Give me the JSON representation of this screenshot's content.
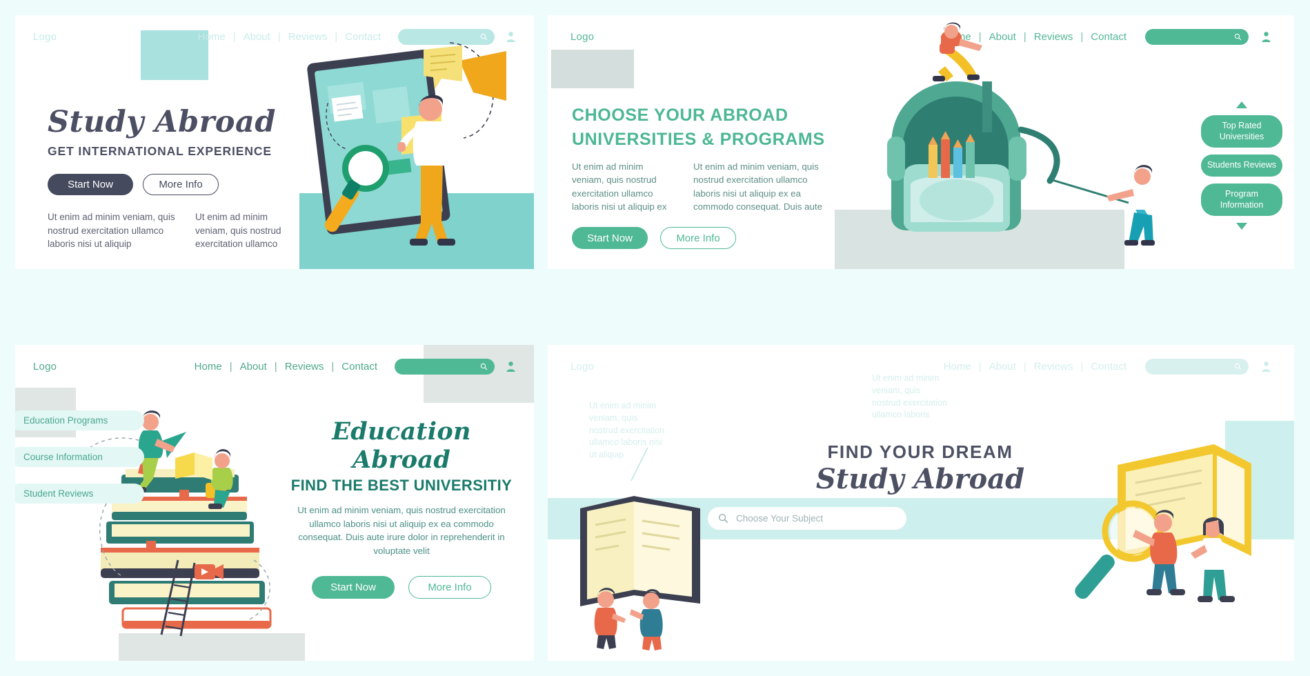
{
  "colors": {
    "page_background": "#eefcfb",
    "accent_green": "#4fb894",
    "dark_teal": "#1a7a6b",
    "slate": "#4c5063",
    "light_teal": "#cdf0ee",
    "pale_teal_text": "#d3efed"
  },
  "panel1": {
    "name": "Study Abroad hero",
    "nav": {
      "logo": "Logo",
      "links": [
        "Home",
        "About",
        "Reviews",
        "Contact"
      ],
      "separator": "|",
      "search_icon": "search-icon",
      "account_icon": "user-icon"
    },
    "heading": "Study Abroad",
    "subheading": "GET INTERNATIONAL EXPERIENCE",
    "primary_button": "Start Now",
    "secondary_button": "More Info",
    "column1": "Ut enim ad minim veniam, quis nostrud exercitation ullamco laboris nisi ut aliquip",
    "column2": "Ut enim ad minim veniam, quis nostrud exercitation ullamco"
  },
  "panel2": {
    "name": "Choose Your Abroad Universities",
    "nav": {
      "logo": "Logo",
      "links": [
        "Home",
        "About",
        "Reviews",
        "Contact"
      ],
      "separator": "|",
      "search_icon": "search-icon",
      "account_icon": "user-icon"
    },
    "heading_line1": "CHOOSE YOUR ABROAD",
    "heading_line2": "UNIVERSITIES & PROGRAMS",
    "column1": "Ut enim ad minim veniam, quis nostrud exercitation ullamco laboris nisi ut aliquip ex",
    "column2": "Ut enim ad minim veniam, quis nostrud exercitation ullamco laboris nisi ut aliquip ex ea commodo consequat. Duis aute",
    "primary_button": "Start Now",
    "secondary_button": "More Info",
    "badges": [
      "Top Rated Universities",
      "Students Reviews",
      "Program Information"
    ],
    "arrow_up": "triangle-up-icon",
    "arrow_down": "triangle-down-icon"
  },
  "panel3": {
    "name": "Education Abroad",
    "nav": {
      "logo": "Logo",
      "links": [
        "Home",
        "About",
        "Reviews",
        "Contact"
      ],
      "separator": "|",
      "search_icon": "search-icon",
      "account_icon": "user-icon"
    },
    "heading": "Education Abroad",
    "subheading": "FIND THE BEST UNIVERSITIY",
    "body": "Ut enim ad minim veniam, quis nostrud exercitation ullamco laboris nisi ut aliquip ex ea commodo consequat. Duis aute irure dolor in reprehenderit in voluptate velit",
    "primary_button": "Start Now",
    "secondary_button": "More Info",
    "side_badges": [
      "Education Programs",
      "Course Information",
      "Student Reviews"
    ]
  },
  "panel4": {
    "name": "Find Your Dream Study Abroad",
    "nav": {
      "logo": "Logo",
      "links": [
        "Home",
        "About",
        "Reviews",
        "Contact"
      ],
      "separator": "|",
      "search_icon": "search-icon",
      "account_icon": "user-icon"
    },
    "ghost_text_left": "Ut enim ad minim veniam, quis nostrud exercitation ullamco laboris nisi ut aliquip",
    "ghost_text_right": "Ut enim ad minim veniam, quis nostrud exercitation ullamco laboris",
    "heading": "FIND YOUR DREAM",
    "subheading": "Study Abroad",
    "search_placeholder": "Choose Your Subject",
    "search_icon": "search-icon"
  }
}
